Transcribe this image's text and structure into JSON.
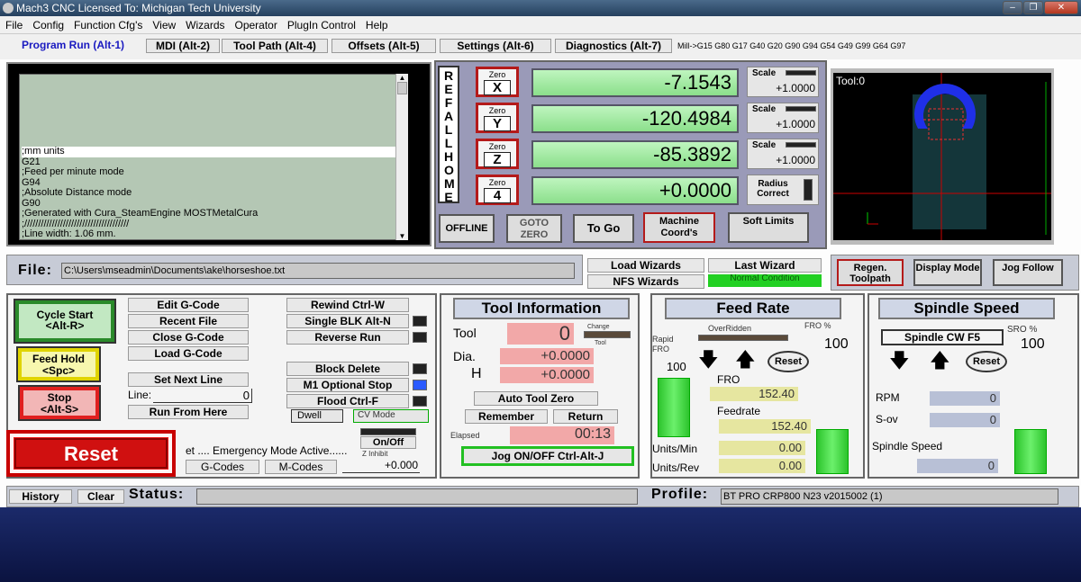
{
  "window": {
    "title": "Mach3 CNC  Licensed To: Michigan Tech University",
    "btn_min": "–",
    "btn_max": "❐",
    "btn_close": "✕"
  },
  "menu": [
    "File",
    "Config",
    "Function Cfg's",
    "View",
    "Wizards",
    "Operator",
    "PlugIn Control",
    "Help"
  ],
  "tabs": [
    "Program Run (Alt-1)",
    "MDI (Alt-2)",
    "Tool Path (Alt-4)",
    "Offsets (Alt-5)",
    "Settings (Alt-6)",
    "Diagnostics (Alt-7)"
  ],
  "modal_line": "Mill->G15  G80 G17 G40 G20 G90 G94 G54 G49 G99 G64 G97",
  "gcode": [
    ";mm units",
    "G21",
    ";Feed per minute mode",
    "G94",
    ";Absolute Distance mode",
    "G90",
    ";Generated with Cura_SteamEngine MOSTMetalCura",
    ";//////////////////////////////////////",
    ";Line width: 1.06 mm."
  ],
  "ref_all_home": "REF ALL HOME",
  "axes": [
    {
      "label": "Zero",
      "axis": "X",
      "value": "-7.1543",
      "scale": "+1.0000"
    },
    {
      "label": "Zero",
      "axis": "Y",
      "value": "-120.4984",
      "scale": "+1.0000"
    },
    {
      "label": "Zero",
      "axis": "Z",
      "value": "-85.3892",
      "scale": "+1.0000"
    },
    {
      "label": "Zero",
      "axis": "4",
      "value": "+0.0000"
    }
  ],
  "scale_label": "Scale",
  "radius_correct": "Radius Correct",
  "dro_buttons": {
    "offline": "OFFLINE",
    "goto_zero": "GOTO ZERO",
    "to_go": "To Go",
    "machine_coords": "Machine Coord's",
    "soft_limits": "Soft Limits"
  },
  "toolview": {
    "label": "Tool:0"
  },
  "file": {
    "label": "File:",
    "path": "C:\\Users\\mseadmin\\Documents\\ake\\horseshoe.txt"
  },
  "wizards": {
    "load": "Load Wizards",
    "last": "Last Wizard",
    "nfs": "NFS Wizards",
    "normal": "Normal Condition"
  },
  "view_buttons": {
    "regen": "Regen. Toolpath",
    "display": "Display Mode",
    "jog": "Jog Follow"
  },
  "control": {
    "cycle_start": "Cycle Start <Alt-R>",
    "feed_hold": "Feed Hold <Spc>",
    "stop": "Stop <Alt-S>",
    "reset": "Reset"
  },
  "program_buttons": {
    "edit": "Edit G-Code",
    "recent": "Recent File",
    "close": "Close G-Code",
    "load": "Load G-Code",
    "set_next": "Set Next Line",
    "run_here": "Run From Here",
    "rewind": "Rewind Ctrl-W",
    "single": "Single BLK Alt-N",
    "reverse": "Reverse Run",
    "block_delete": "Block Delete",
    "optional_stop": "M1 Optional Stop",
    "flood": "Flood Ctrl-F",
    "dwell": "Dwell",
    "cv_mode": "CV Mode",
    "line_label": "Line:",
    "line_value": "0",
    "onoff": "On/Off",
    "z_inhibit": "Z Inhibit",
    "z_inhibit_val": "+0.000",
    "gcodes": "G-Codes",
    "mcodes": "M-Codes",
    "emergency": "et .... Emergency Mode Active......"
  },
  "tool_info": {
    "title": "Tool Information",
    "tool_label": "Tool",
    "tool_value": "0",
    "change": "Change",
    "tool_led": "Tool",
    "dia_label": "Dia.",
    "dia_value": "+0.0000",
    "h_label": "H",
    "h_value": "+0.0000",
    "auto_zero": "Auto Tool Zero",
    "remember": "Remember",
    "return": "Return",
    "elapsed_label": "Elapsed",
    "elapsed": "00:13",
    "jog": "Jog ON/OFF Ctrl-Alt-J"
  },
  "feed": {
    "title": "Feed Rate",
    "overridden": "OverRidden",
    "fro_pct_label": "FRO %",
    "fro_pct": "100",
    "rapid_label": "Rapid FRO",
    "rapid": "100",
    "reset": "Reset",
    "fro_label": "FRO",
    "fro": "152.40",
    "feedrate_label": "Feedrate",
    "feedrate": "152.40",
    "units_min_label": "Units/Min",
    "units_min": "0.00",
    "units_rev_label": "Units/Rev",
    "units_rev": "0.00",
    "fro_level": 100
  },
  "spindle": {
    "title": "Spindle Speed",
    "cw": "Spindle CW F5",
    "sro_label": "SRO %",
    "sro": "100",
    "reset": "Reset",
    "rpm_label": "RPM",
    "rpm": "0",
    "sov_label": "S-ov",
    "sov": "0",
    "speed_label": "Spindle Speed",
    "speed": "0"
  },
  "status": {
    "history": "History",
    "clear": "Clear",
    "label": "Status:",
    "profile_label": "Profile:",
    "profile": "BT PRO CRP800 N23 v2015002 (1)"
  }
}
